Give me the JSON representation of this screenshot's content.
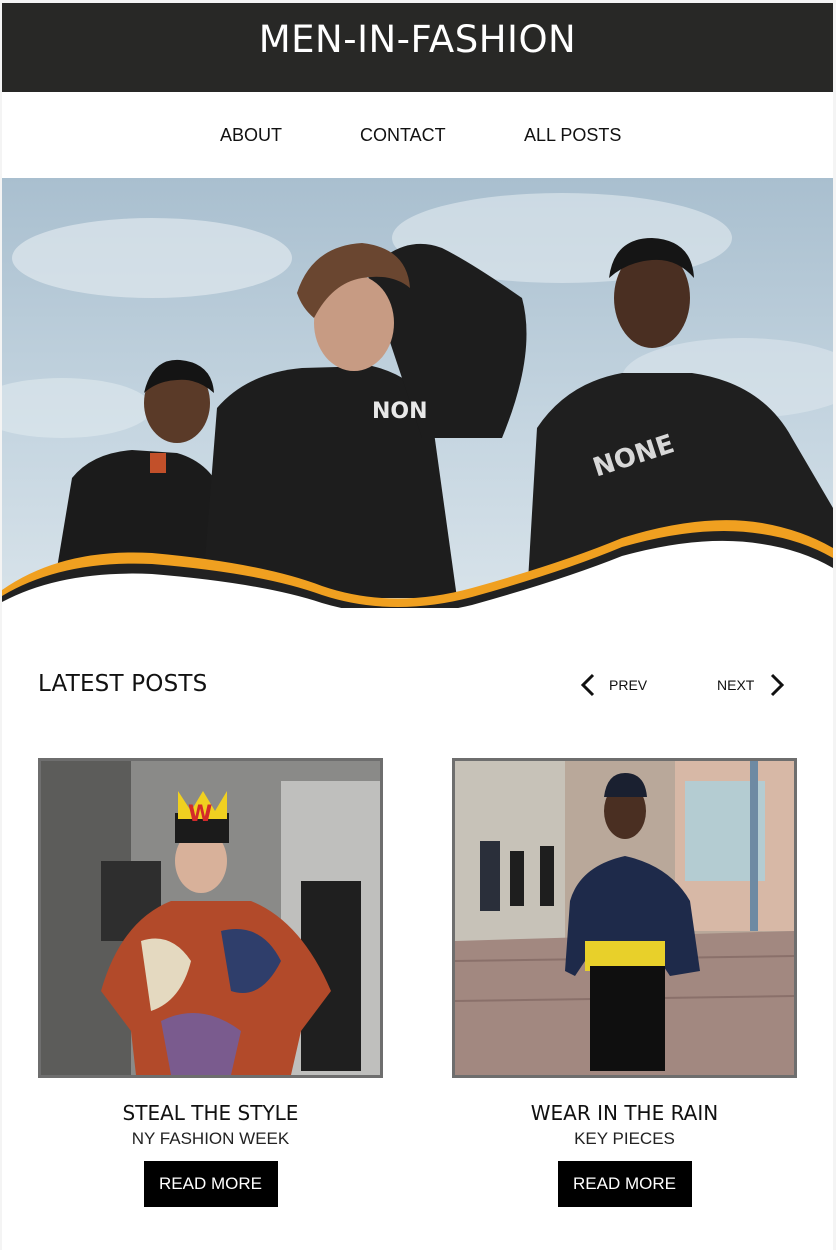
{
  "site": {
    "title": "MEN-IN-FASHION"
  },
  "nav": {
    "items": [
      {
        "label": "ABOUT"
      },
      {
        "label": "CONTACT"
      },
      {
        "label": "ALL POSTS"
      }
    ]
  },
  "latest": {
    "heading": "LATEST POSTS",
    "prev_label": "PREV",
    "next_label": "NEXT"
  },
  "posts": [
    {
      "title": "STEAL THE STYLE",
      "subtitle": "NY FASHION WEEK",
      "button_label": "READ MORE"
    },
    {
      "title": "WEAR IN THE RAIN",
      "subtitle": "KEY PIECES",
      "button_label": "READ MORE"
    }
  ],
  "colors": {
    "header_bg": "#282826",
    "accent_wave": "#f0a020",
    "button_bg": "#000000"
  },
  "icons": [
    "chevron-left-icon",
    "chevron-right-icon"
  ]
}
